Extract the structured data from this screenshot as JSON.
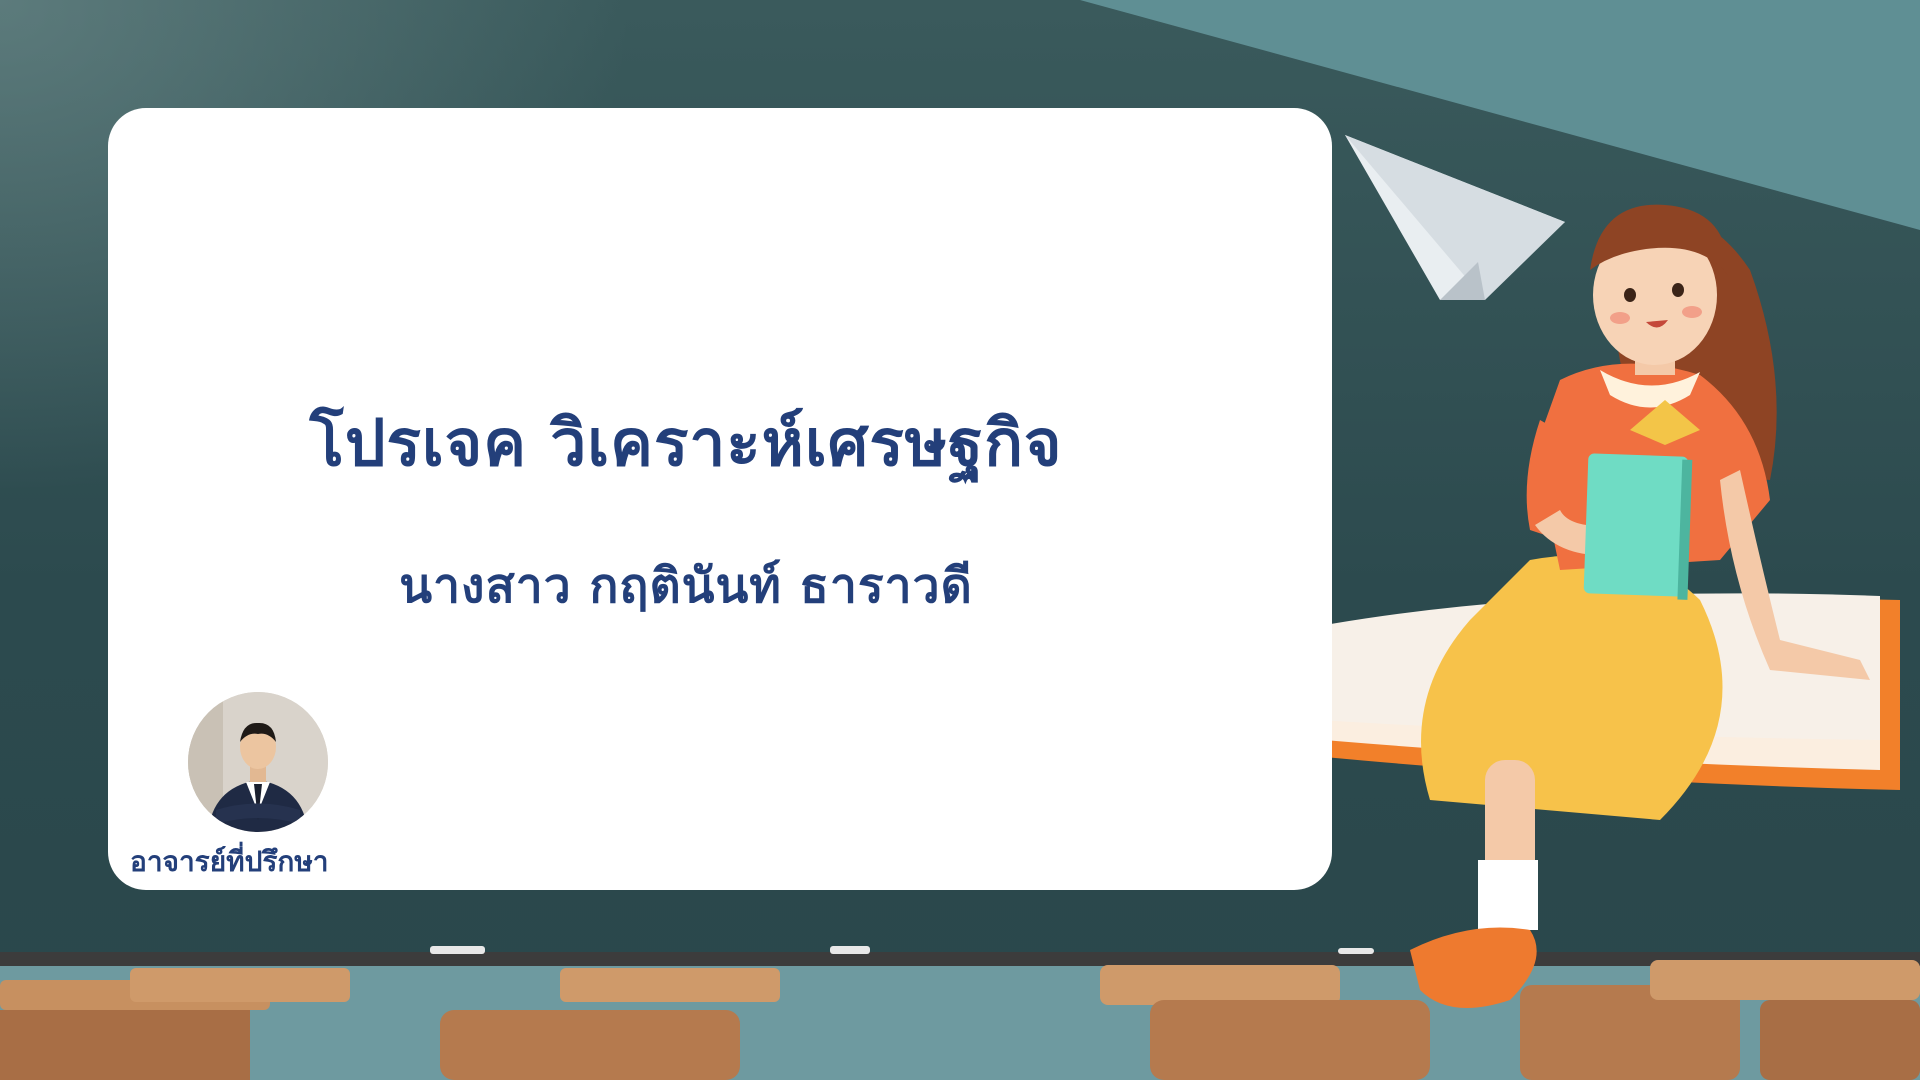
{
  "slide": {
    "title": "โปรเจค วิเคราะห์เศรษฐกิจ",
    "subtitle": "นางสาว กฤตินันท์ ธาราวดี",
    "advisor_label": "อาจารย์ที่ปรึกษา"
  },
  "colors": {
    "text": "#233f7a",
    "card": "#ffffff",
    "board": "#2c4a4e",
    "teal_light": "#5f8d92"
  },
  "icons": {
    "plane": "paper-plane-icon"
  }
}
